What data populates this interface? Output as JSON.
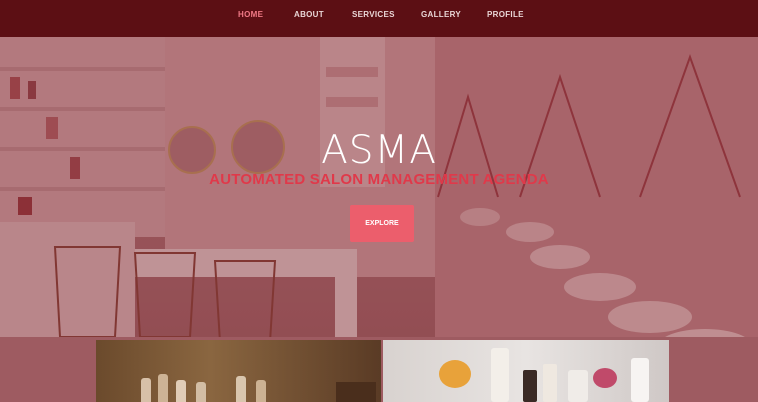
{
  "nav": {
    "items": [
      {
        "label": "HOME",
        "active": true
      },
      {
        "label": "ABOUT",
        "active": false
      },
      {
        "label": "SERVICES",
        "active": false
      },
      {
        "label": "GALLERY",
        "active": false
      },
      {
        "label": "PROFILE",
        "active": false
      }
    ]
  },
  "hero": {
    "title": "ASMA",
    "subtitle": "AUTOMATED SALON MANAGEMENT AGENDA",
    "button_label": "EXPLORE"
  },
  "colors": {
    "nav_bg": "#5c0f14",
    "nav_active": "#f07a86",
    "accent": "#ec5e6c",
    "subtitle": "#e0394a"
  }
}
